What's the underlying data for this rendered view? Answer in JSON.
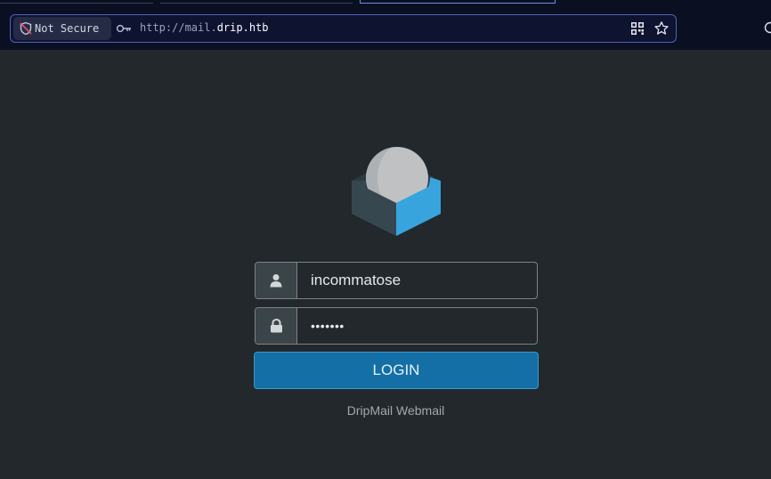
{
  "browser": {
    "security_label": "Not Secure",
    "url_scheme": "http://mail.",
    "url_host": "drip.htb"
  },
  "login": {
    "username_value": "incommatose",
    "password_value": "•••••••",
    "submit_label": "LOGIN",
    "footer_text": "DripMail Webmail"
  },
  "colors": {
    "accent": "#136fa5",
    "background": "#22282b"
  }
}
